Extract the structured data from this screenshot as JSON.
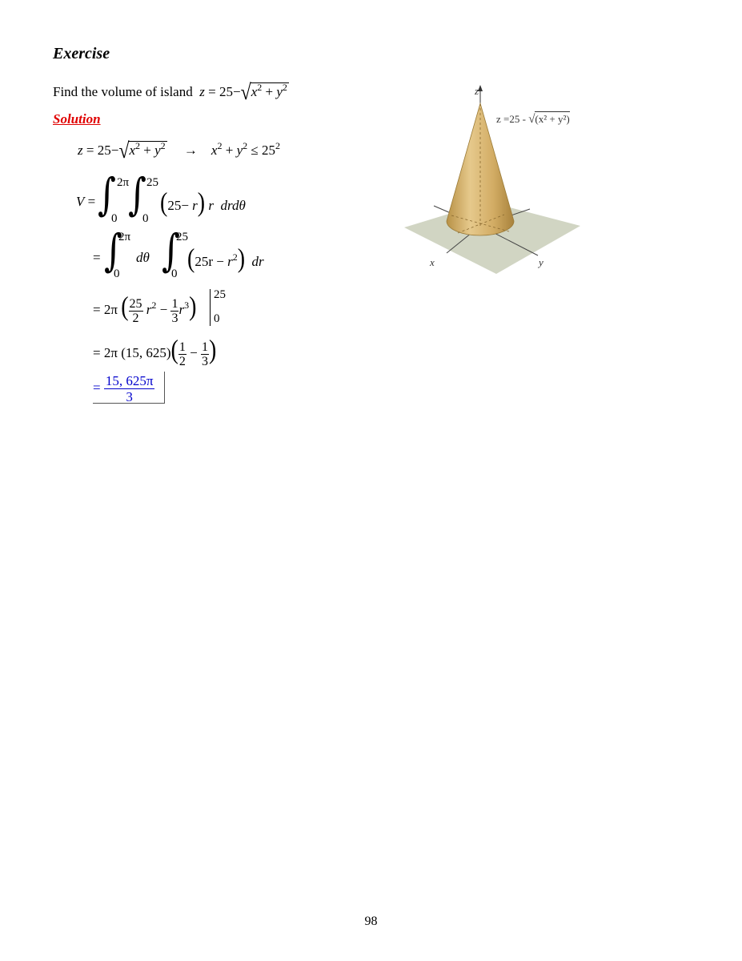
{
  "heading": "Exercise",
  "problem": {
    "text": "Find the volume of island",
    "z": "z",
    "eq": "=",
    "c": "25",
    "minus": "−",
    "x": "x",
    "two": "2",
    "plus": "+",
    "y": "y"
  },
  "solution_label": "Solution",
  "step1": {
    "z": "z",
    "eq": "=",
    "c": "25",
    "minus": "−",
    "x": "x",
    "two": "2",
    "plus": "+",
    "y": "y",
    "arrow": "→",
    "le": "≤",
    "c2": "25"
  },
  "step2": {
    "V": "V",
    "eq": "=",
    "upper1": "2π",
    "lower1": "0",
    "upper2": "25",
    "lower2": "0",
    "lp": "(",
    "c": "25",
    "minus": "−",
    "r": "r",
    "rp": ")",
    "r2": "r",
    "d": "drdθ"
  },
  "step3": {
    "eq": "=",
    "upper1": "2π",
    "lower1": "0",
    "dtheta": "dθ",
    "upper2": "25",
    "lower2": "0",
    "lp": "(",
    "t1": "25r",
    "minus": "−",
    "r": "r",
    "two": "2",
    "rp": ")",
    "dr": "dr"
  },
  "step4": {
    "eq": "=",
    "coef": "2π",
    "lp": "(",
    "n1": "25",
    "d1": "2",
    "r": "r",
    "two": "2",
    "minus": "−",
    "n2": "1",
    "d2": "3",
    "three": "3",
    "rp": ")",
    "upper": "25",
    "lower": "0"
  },
  "step5": {
    "eq": "=",
    "coef": "2π",
    "val": "(15, 625)",
    "lp": "(",
    "n1": "1",
    "d1": "2",
    "minus": "−",
    "n2": "1",
    "d2": "3",
    "rp": ")"
  },
  "answer": {
    "eq": "=",
    "num": "15, 625π",
    "den": "3"
  },
  "figure": {
    "z_label": "z",
    "x_label": "x",
    "y_label": "y",
    "eq_label": "z =25 -",
    "eq_inner": "(x² + y²)",
    "cone_color": "#d4b06a"
  },
  "page_number": "98"
}
